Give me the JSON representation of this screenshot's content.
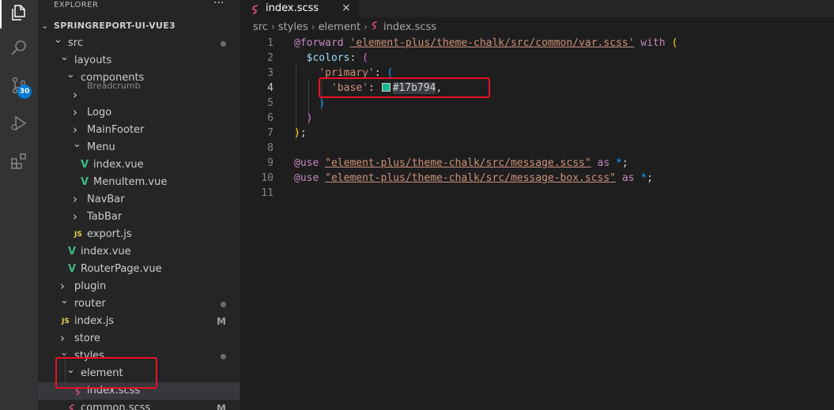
{
  "activity_bar": {
    "source_control_badge": "30",
    "items": [
      "explorer-icon",
      "search-icon",
      "source-control-icon",
      "run-debug-icon",
      "extensions-icon"
    ]
  },
  "sidebar": {
    "title": "EXPLORER",
    "more_actions": "···",
    "workspace": "SPRINGREPORT-UI-VUE3",
    "tree": [
      {
        "label": "src",
        "type": "folder",
        "expanded": true,
        "modified_dot": true
      },
      {
        "label": "layouts",
        "type": "folder",
        "expanded": true
      },
      {
        "label": "components",
        "type": "folder",
        "expanded": true
      },
      {
        "label": "Breadcrumb",
        "type": "folder",
        "expanded": false
      },
      {
        "label": "Logo",
        "type": "folder",
        "expanded": false
      },
      {
        "label": "MainFooter",
        "type": "folder",
        "expanded": false
      },
      {
        "label": "Menu",
        "type": "folder",
        "expanded": true
      },
      {
        "label": "index.vue",
        "type": "vue"
      },
      {
        "label": "MenuItem.vue",
        "type": "vue"
      },
      {
        "label": "NavBar",
        "type": "folder",
        "expanded": false
      },
      {
        "label": "TabBar",
        "type": "folder",
        "expanded": false
      },
      {
        "label": "export.js",
        "type": "js"
      },
      {
        "label": "index.vue",
        "type": "vue"
      },
      {
        "label": "RouterPage.vue",
        "type": "vue"
      },
      {
        "label": "plugin",
        "type": "folder",
        "expanded": false
      },
      {
        "label": "router",
        "type": "folder",
        "expanded": true,
        "modified_dot": true
      },
      {
        "label": "index.js",
        "type": "js",
        "status": "M"
      },
      {
        "label": "store",
        "type": "folder",
        "expanded": false
      },
      {
        "label": "styles",
        "type": "folder",
        "expanded": true,
        "modified_dot": true
      },
      {
        "label": "element",
        "type": "folder",
        "expanded": true
      },
      {
        "label": "index.scss",
        "type": "scss",
        "selected": true
      },
      {
        "label": "common.scss",
        "type": "scss",
        "status": "M"
      }
    ],
    "file_icon_text": {
      "js": "JS",
      "vue": "V"
    }
  },
  "tab": {
    "label": "index.scss",
    "close": "×"
  },
  "breadcrumb": [
    "src",
    "styles",
    "element",
    "index.scss"
  ],
  "editor": {
    "current_line": 4,
    "lines": [
      {
        "n": "1",
        "tokens": [
          {
            "t": "@forward",
            "c": "kw"
          },
          {
            "t": " ",
            "c": "plain"
          },
          {
            "t": "'element-plus/theme-chalk/src/common/var.scss'",
            "c": "str ul"
          },
          {
            "t": " with ",
            "c": "kw"
          },
          {
            "t": "(",
            "c": "b1"
          }
        ]
      },
      {
        "n": "2",
        "tokens": [
          {
            "t": "  ",
            "c": "plain"
          },
          {
            "t": "$colors",
            "c": "var"
          },
          {
            "t": ": ",
            "c": "op"
          },
          {
            "t": "(",
            "c": "b2"
          }
        ]
      },
      {
        "n": "3",
        "tokens": [
          {
            "t": "    ",
            "c": "plain"
          },
          {
            "t": "'primary'",
            "c": "str"
          },
          {
            "t": ": ",
            "c": "op"
          },
          {
            "t": "(",
            "c": "b3"
          }
        ]
      },
      {
        "n": "4",
        "tokens": [
          {
            "t": "      ",
            "c": "plain"
          },
          {
            "t": "'base'",
            "c": "str"
          },
          {
            "t": ": ",
            "c": "op"
          },
          {
            "t": "",
            "c": "swatch"
          },
          {
            "t": "#17b794",
            "c": "hex"
          },
          {
            "t": ",",
            "c": "op"
          }
        ]
      },
      {
        "n": "5",
        "tokens": [
          {
            "t": "    ",
            "c": "plain"
          },
          {
            "t": ")",
            "c": "b3"
          }
        ]
      },
      {
        "n": "6",
        "tokens": [
          {
            "t": "  ",
            "c": "plain"
          },
          {
            "t": ")",
            "c": "b2"
          }
        ]
      },
      {
        "n": "7",
        "tokens": [
          {
            "t": ")",
            "c": "b1"
          },
          {
            "t": ";",
            "c": "op"
          }
        ]
      },
      {
        "n": "8",
        "tokens": []
      },
      {
        "n": "9",
        "tokens": [
          {
            "t": "@use",
            "c": "kw"
          },
          {
            "t": " ",
            "c": "plain"
          },
          {
            "t": "\"element-plus/theme-chalk/src/message.scss\"",
            "c": "str ul"
          },
          {
            "t": " as ",
            "c": "kw"
          },
          {
            "t": "*",
            "c": "b3"
          },
          {
            "t": ";",
            "c": "op"
          }
        ]
      },
      {
        "n": "10",
        "tokens": [
          {
            "t": "@use",
            "c": "kw"
          },
          {
            "t": " ",
            "c": "plain"
          },
          {
            "t": "\"element-plus/theme-chalk/src/message-box.scss\"",
            "c": "str ul"
          },
          {
            "t": " as ",
            "c": "kw"
          },
          {
            "t": "*",
            "c": "b3"
          },
          {
            "t": ";",
            "c": "op"
          }
        ]
      },
      {
        "n": "11",
        "tokens": []
      }
    ]
  },
  "colors": {
    "swatch": "#17b794",
    "scss_icon": "#f55385",
    "vue_icon": "#41b883",
    "js_icon": "#e8d44d",
    "annotation_box": "#e81123"
  }
}
